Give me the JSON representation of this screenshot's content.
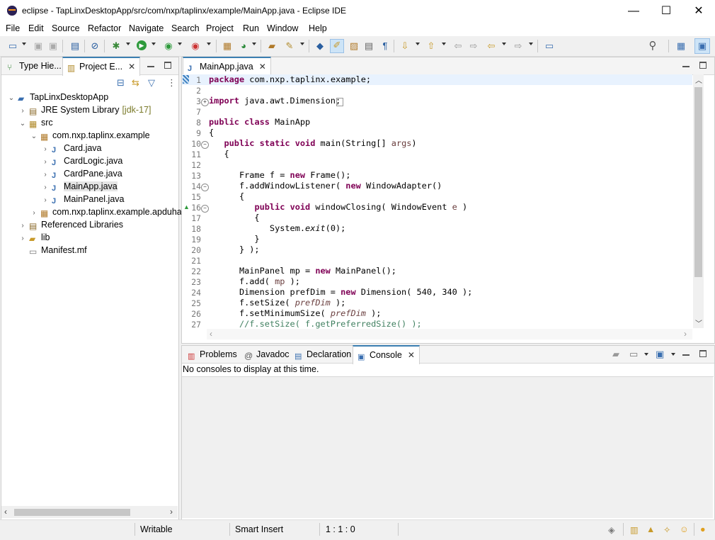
{
  "window": {
    "title": "eclipse - TapLinxDesktopApp/src/com/nxp/taplinx/example/MainApp.java - Eclipse IDE",
    "minimize": "—",
    "maximize": "☐",
    "close": "✕"
  },
  "menu": [
    "File",
    "Edit",
    "Source",
    "Refactor",
    "Navigate",
    "Search",
    "Project",
    "Run",
    "Window",
    "Help"
  ],
  "left_pane": {
    "tabs": [
      {
        "label": "Type Hie..."
      },
      {
        "label": "Project E...",
        "active": true
      }
    ],
    "tree": [
      {
        "label": "TapLinxDesktopApp",
        "twisty": "⌄",
        "icon": "project-folder-icon"
      },
      {
        "label": "JRE System Library",
        "suffix": "[jdk-17]",
        "twisty": "›",
        "icon": "library-icon"
      },
      {
        "label": "src",
        "twisty": "⌄",
        "icon": "source-folder-icon"
      },
      {
        "label": "com.nxp.taplinx.example",
        "twisty": "⌄",
        "icon": "package-icon"
      },
      {
        "label": "Card.java",
        "twisty": "›",
        "icon": "java-file-icon"
      },
      {
        "label": "CardLogic.java",
        "twisty": "›",
        "icon": "java-file-icon"
      },
      {
        "label": "CardPane.java",
        "twisty": "›",
        "icon": "java-file-icon"
      },
      {
        "label": "MainApp.java",
        "twisty": "›",
        "icon": "java-file-icon",
        "selected": true
      },
      {
        "label": "MainPanel.java",
        "twisty": "›",
        "icon": "java-file-icon"
      },
      {
        "label": "com.nxp.taplinx.example.apduha",
        "twisty": "›",
        "icon": "package-icon"
      },
      {
        "label": "Referenced Libraries",
        "twisty": "›",
        "icon": "library-icon"
      },
      {
        "label": "lib",
        "twisty": "›",
        "icon": "folder-icon"
      },
      {
        "label": "Manifest.mf",
        "twisty": "",
        "icon": "file-icon"
      }
    ]
  },
  "editor": {
    "tab": "MainApp.java",
    "lines": [
      {
        "n": "1",
        "text": "package com.nxp.taplinx.example;"
      },
      {
        "n": "2",
        "text": ""
      },
      {
        "n": "3",
        "text": "import java.awt.Dimension;"
      },
      {
        "n": "7",
        "text": ""
      },
      {
        "n": "8",
        "text": "public class MainApp"
      },
      {
        "n": "9",
        "text": "{"
      },
      {
        "n": "10",
        "text": "   public static void main(String[] args)"
      },
      {
        "n": "11",
        "text": "   {"
      },
      {
        "n": "12",
        "text": ""
      },
      {
        "n": "13",
        "text": "      Frame f = new Frame();"
      },
      {
        "n": "14",
        "text": "      f.addWindowListener( new WindowAdapter()"
      },
      {
        "n": "15",
        "text": "      {"
      },
      {
        "n": "16",
        "text": "         public void windowClosing( WindowEvent e )"
      },
      {
        "n": "17",
        "text": "         {"
      },
      {
        "n": "18",
        "text": "            System.exit(0);"
      },
      {
        "n": "19",
        "text": "         }"
      },
      {
        "n": "20",
        "text": "      } );"
      },
      {
        "n": "21",
        "text": ""
      },
      {
        "n": "22",
        "text": "      MainPanel mp = new MainPanel();"
      },
      {
        "n": "23",
        "text": "      f.add( mp );"
      },
      {
        "n": "24",
        "text": "      Dimension prefDim = new Dimension( 540, 340 );"
      },
      {
        "n": "25",
        "text": "      f.setSize( prefDim );"
      },
      {
        "n": "26",
        "text": "      f.setMinimumSize( prefDim );"
      },
      {
        "n": "27",
        "text": "      //f.setSize( f.getPreferredSize() );"
      }
    ]
  },
  "bottom_pane": {
    "tabs": [
      {
        "label": "Problems",
        "icon": "problems-icon"
      },
      {
        "label": "Javadoc",
        "icon": "javadoc-icon"
      },
      {
        "label": "Declaration",
        "icon": "declaration-icon"
      },
      {
        "label": "Console",
        "icon": "console-icon",
        "active": true
      }
    ],
    "message": "No consoles to display at this time."
  },
  "status": {
    "writable": "Writable",
    "insert_mode": "Smart Insert",
    "position": "1 : 1 : 0"
  },
  "colors": {
    "keyword": "#7f0055",
    "comment": "#3f7f5f",
    "active_tab": "#3c7fb1"
  }
}
